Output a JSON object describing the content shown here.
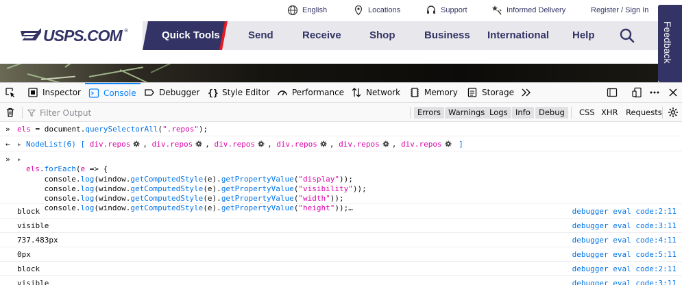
{
  "site": {
    "utility": [
      {
        "icon": "globe-icon",
        "label": "English"
      },
      {
        "icon": "location-pin-icon",
        "label": "Locations"
      },
      {
        "icon": "headset-icon",
        "label": "Support"
      },
      {
        "icon": "informed-delivery-icon",
        "label": "Informed Delivery"
      },
      {
        "icon": "",
        "label": "Register / Sign In"
      }
    ],
    "logo": "USPS.COM",
    "logo_reg": "®",
    "nav": {
      "quick_tools": "Quick Tools",
      "items": [
        "Send",
        "Receive",
        "Shop",
        "Business",
        "International",
        "Help"
      ]
    },
    "feedback": "Feedback"
  },
  "devtools": {
    "tabs": [
      {
        "icon": "inspector-icon",
        "label": "Inspector"
      },
      {
        "icon": "console-icon",
        "label": "Console"
      },
      {
        "icon": "debugger-icon",
        "label": "Debugger"
      },
      {
        "icon": "style-editor-icon",
        "label": "Style Editor"
      },
      {
        "icon": "performance-icon",
        "label": "Performance"
      },
      {
        "icon": "network-icon",
        "label": "Network"
      },
      {
        "icon": "memory-icon",
        "label": "Memory"
      },
      {
        "icon": "storage-icon",
        "label": "Storage"
      }
    ],
    "active_tab": "Console",
    "filter_placeholder": "Filter Output",
    "filters": [
      "Errors",
      "Warnings",
      "Logs",
      "Info",
      "Debug"
    ],
    "net_filters": [
      "CSS",
      "XHR",
      "Requests"
    ],
    "console": {
      "input1": {
        "code": "els = document.querySelectorAll(\".repos\");"
      },
      "result1": {
        "prefix": "NodeList(6)",
        "open": "[",
        "items": [
          "div.repos",
          "div.repos",
          "div.repos",
          "div.repos",
          "div.repos",
          "div.repos"
        ],
        "close": "]"
      },
      "input2": {
        "lines": [
          "els.forEach(e => {",
          "    console.log(window.getComputedStyle(e).getPropertyValue(\"display\"));",
          "    console.log(window.getComputedStyle(e).getPropertyValue(\"visibility\"));",
          "    console.log(window.getComputedStyle(e).getPropertyValue(\"width\"));",
          "    console.log(window.getComputedStyle(e).getPropertyValue(\"height\"));…"
        ]
      },
      "logs": [
        {
          "value": "block",
          "location": "debugger eval code:2:11"
        },
        {
          "value": "visible",
          "location": "debugger eval code:3:11"
        },
        {
          "value": "737.483px",
          "location": "debugger eval code:4:11"
        },
        {
          "value": "0px",
          "location": "debugger eval code:5:11"
        },
        {
          "value": "block",
          "location": "debugger eval code:2:11"
        },
        {
          "value": "visible",
          "location": "debugger eval code:3:11"
        }
      ]
    }
  },
  "colors": {
    "usps_blue": "#333366",
    "usps_red": "#e71921",
    "devtools_accent": "#0a84ff"
  }
}
